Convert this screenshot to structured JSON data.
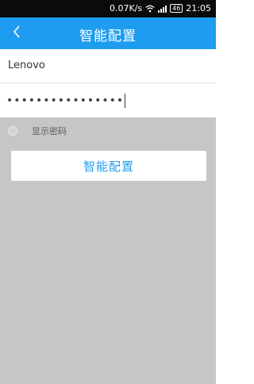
{
  "status_bar": {
    "speed": "0.07K/s",
    "battery": "46",
    "time": "21:05"
  },
  "app_bar": {
    "title": "智能配置",
    "back_icon": "chevron-left-icon"
  },
  "form": {
    "ssid_value": "Lenovo",
    "password_masked": "••••••••••••••••"
  },
  "options": {
    "show_password_label": "显示密码",
    "show_password_checked": false
  },
  "actions": {
    "config_button_label": "智能配置"
  },
  "colors": {
    "accent": "#1e9df0",
    "status_bar": "#0b0b0b",
    "backdrop": "#c6c6c6"
  }
}
